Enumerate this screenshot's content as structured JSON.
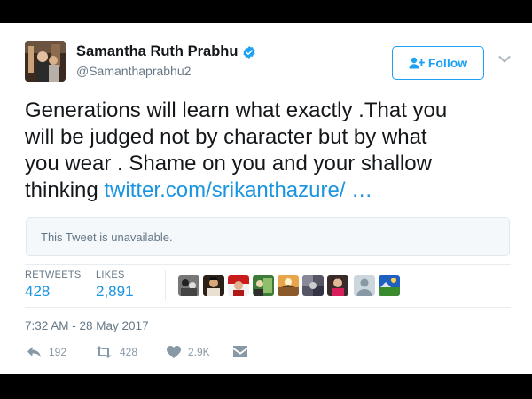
{
  "user": {
    "display_name": "Samantha Ruth Prabhu",
    "handle": "@Samanthaprabhu2",
    "verified": true,
    "avatar_icon": "profile-photo"
  },
  "follow_button": {
    "label": "Follow",
    "icon": "add-user-icon"
  },
  "tweet": {
    "text_line1": "Generations will learn what exactly .That you",
    "text_line2": "will be judged not by character but by what",
    "text_line3": "you wear . Shame on you and your shallow",
    "text_line4_prefix": "thinking ",
    "link": "twitter.com/srikanthazure/ …"
  },
  "quoted_tweet": {
    "text": "This Tweet is unavailable."
  },
  "stats": {
    "retweets_label": "RETWEETS",
    "retweets_value": "428",
    "likes_label": "LIKES",
    "likes_value": "2,891"
  },
  "likers": [
    "liker-avatar-1",
    "liker-avatar-2",
    "liker-avatar-3",
    "liker-avatar-4",
    "liker-avatar-5",
    "liker-avatar-6",
    "liker-avatar-7",
    "liker-avatar-8",
    "liker-avatar-9"
  ],
  "timestamp": "7:32 AM - 28 May 2017",
  "actions": {
    "reply_count": "192",
    "retweet_count": "428",
    "like_count": "2.9K"
  },
  "colors": {
    "accent": "#1da1f2",
    "link": "#1b95e0",
    "muted": "#657786",
    "text": "#14171a"
  }
}
